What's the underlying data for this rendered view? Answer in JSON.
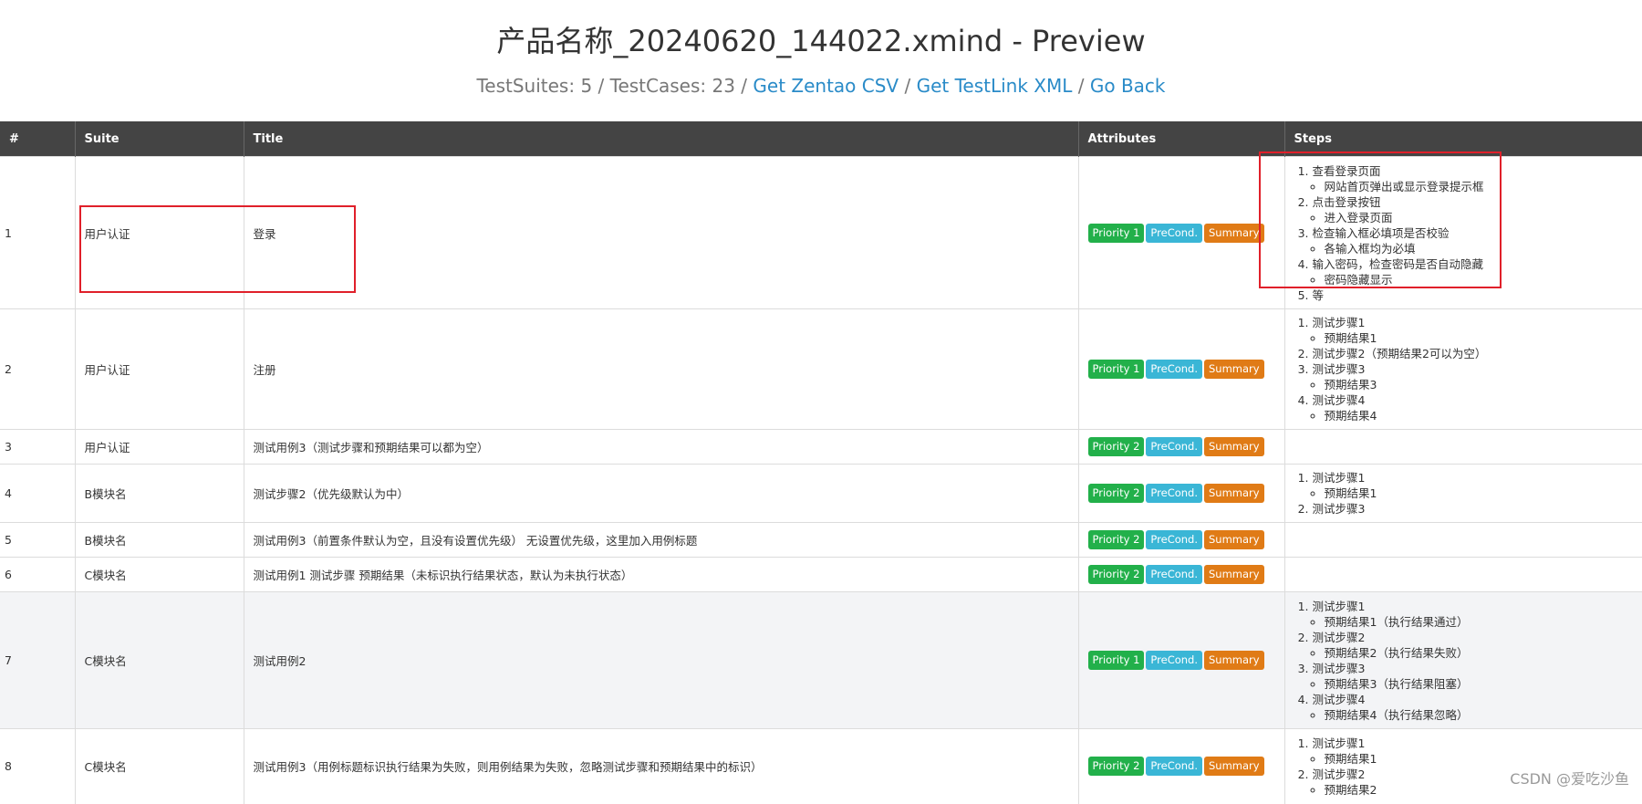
{
  "header": {
    "title": "产品名称_20240620_144022.xmind - Preview",
    "stats_text": "TestSuites: 5 / TestCases: 23",
    "sep": "/",
    "links": [
      "Get Zentao CSV",
      "Get TestLink XML",
      "Go Back"
    ]
  },
  "table": {
    "columns": [
      "#",
      "Suite",
      "Title",
      "Attributes",
      "Steps"
    ],
    "badge_labels": {
      "precond": "PreCond.",
      "summary": "Summary"
    },
    "rows": [
      {
        "num": "1",
        "suite": "用户认证",
        "title": "登录",
        "priority": "Priority 1",
        "steps": [
          {
            "step": "查看登录页面",
            "result": "网站首页弹出或显示登录提示框"
          },
          {
            "step": "点击登录按钮",
            "result": "进入登录页面"
          },
          {
            "step": "检查输入框必填项是否校验",
            "result": "各输入框均为必填"
          },
          {
            "step": "输入密码，检查密码是否自动隐藏",
            "result": "密码隐藏显示"
          },
          {
            "step": "等",
            "result": ""
          }
        ]
      },
      {
        "num": "2",
        "suite": "用户认证",
        "title": "注册",
        "priority": "Priority 1",
        "steps": [
          {
            "step": "测试步骤1",
            "result": "预期结果1"
          },
          {
            "step": "测试步骤2（预期结果2可以为空）",
            "result": ""
          },
          {
            "step": "测试步骤3",
            "result": "预期结果3"
          },
          {
            "step": "测试步骤4",
            "result": "预期结果4"
          }
        ]
      },
      {
        "num": "3",
        "suite": "用户认证",
        "title": "测试用例3（测试步骤和预期结果可以都为空）",
        "priority": "Priority 2",
        "steps": []
      },
      {
        "num": "4",
        "suite": "B模块名",
        "title": "测试步骤2（优先级默认为中）",
        "priority": "Priority 2",
        "steps": [
          {
            "step": "测试步骤1",
            "result": "预期结果1"
          },
          {
            "step": "测试步骤3",
            "result": ""
          }
        ]
      },
      {
        "num": "5",
        "suite": "B模块名",
        "title": "测试用例3（前置条件默认为空，且没有设置优先级） 无设置优先级，这里加入用例标题",
        "priority": "Priority 2",
        "steps": []
      },
      {
        "num": "6",
        "suite": "C模块名",
        "title": "测试用例1 测试步骤 预期结果（未标识执行结果状态，默认为未执行状态）",
        "priority": "Priority 2",
        "steps": []
      },
      {
        "num": "7",
        "suite": "C模块名",
        "title": "测试用例2",
        "priority": "Priority 1",
        "steps": [
          {
            "step": "测试步骤1",
            "result": "预期结果1（执行结果通过）"
          },
          {
            "step": "测试步骤2",
            "result": "预期结果2（执行结果失败）"
          },
          {
            "step": "测试步骤3",
            "result": "预期结果3（执行结果阻塞）"
          },
          {
            "step": "测试步骤4",
            "result": "预期结果4（执行结果忽略）"
          }
        ]
      },
      {
        "num": "8",
        "suite": "C模块名",
        "title": "测试用例3（用例标题标识执行结果为失败，则用例结果为失败，忽略测试步骤和预期结果中的标识）",
        "priority": "Priority 2",
        "steps": [
          {
            "step": "测试步骤1",
            "result": "预期结果1"
          },
          {
            "step": "测试步骤2",
            "result": "预期结果2"
          }
        ]
      }
    ]
  },
  "watermark": "CSDN @爱吃沙鱼",
  "colors": {
    "header_bg": "#444444",
    "link": "#2a8bc8",
    "priority": "#22b04a",
    "precond": "#3ab6d6",
    "summary": "#e07b16",
    "highlight": "#e0202a"
  }
}
